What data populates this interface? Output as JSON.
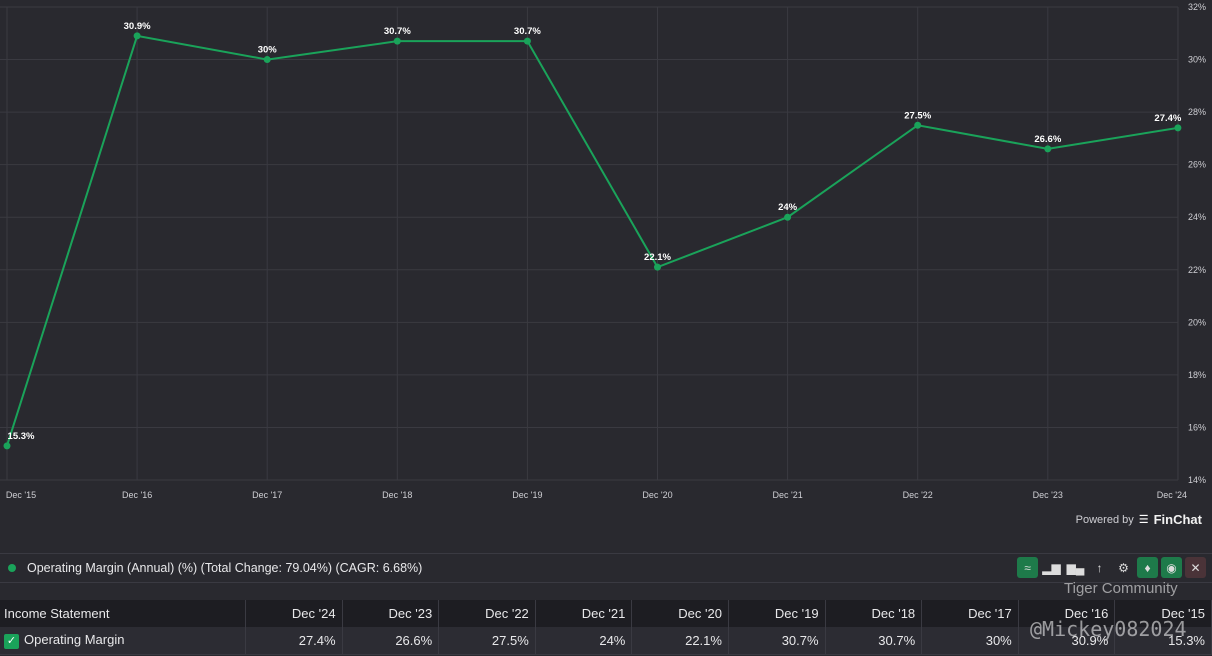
{
  "chart_data": {
    "type": "line",
    "categories": [
      "Dec '15",
      "Dec '16",
      "Dec '17",
      "Dec '18",
      "Dec '19",
      "Dec '20",
      "Dec '21",
      "Dec '22",
      "Dec '23",
      "Dec '24"
    ],
    "series": [
      {
        "name": "Operating Margin (Annual) (%)",
        "values": [
          15.3,
          30.9,
          30,
          30.7,
          30.7,
          22.1,
          24,
          27.5,
          26.6,
          27.4
        ],
        "labels": [
          "15.3%",
          "30.9%",
          "30%",
          "30.7%",
          "30.7%",
          "22.1%",
          "24%",
          "27.5%",
          "26.6%",
          "27.4%"
        ],
        "color": "#1aa35a"
      }
    ],
    "ylim": [
      14,
      32
    ],
    "yticks": [
      "14%",
      "16%",
      "18%",
      "20%",
      "22%",
      "24%",
      "26%",
      "28%",
      "30%",
      "32%"
    ],
    "grid": true
  },
  "powered": {
    "label": "Powered by",
    "brand": "FinChat"
  },
  "legend": {
    "text": "Operating Margin (Annual) (%) (Total Change: 79.04%) (CAGR: 6.68%)"
  },
  "table": {
    "header": "Income Statement",
    "columns": [
      "Dec '24",
      "Dec '23",
      "Dec '22",
      "Dec '21",
      "Dec '20",
      "Dec '19",
      "Dec '18",
      "Dec '17",
      "Dec '16",
      "Dec '15"
    ],
    "row": {
      "label": "Operating Margin",
      "values": [
        "27.4%",
        "26.6%",
        "27.5%",
        "24%",
        "22.1%",
        "30.7%",
        "30.7%",
        "30%",
        "30.9%",
        "15.3%"
      ]
    }
  },
  "watermark": {
    "brand": "Tiger Community",
    "user": "@Mickey082024"
  }
}
